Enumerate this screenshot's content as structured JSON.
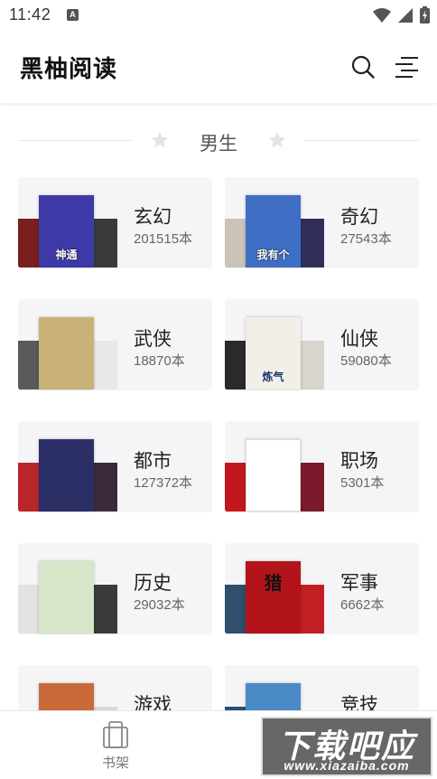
{
  "status_bar": {
    "time": "11:42",
    "notification_icon": "a-icon",
    "icons": [
      "wifi-icon",
      "cellular-icon",
      "battery-icon"
    ]
  },
  "header": {
    "title": "黑柚阅读",
    "search_icon": "search-icon",
    "menu_icon": "menu-icon"
  },
  "section": {
    "title": "男生"
  },
  "categories": [
    {
      "name": "玄幻",
      "count": "201515本",
      "cover_text": "神通",
      "colors": {
        "front": "#3d3aa8",
        "back_left": "#7a1f1f",
        "back_right": "#3a3a3a"
      }
    },
    {
      "name": "奇幻",
      "count": "27543本",
      "cover_text": "我有个",
      "colors": {
        "front": "#3f6fc4",
        "back_left": "#c9c3b8",
        "back_right": "#2f2f5a"
      }
    },
    {
      "name": "武侠",
      "count": "18870本",
      "cover_text": "",
      "colors": {
        "front": "#c9b27a",
        "back_left": "#5a5a5a",
        "back_right": "#e8e8e8"
      }
    },
    {
      "name": "仙侠",
      "count": "59080本",
      "cover_text": "炼气",
      "colors": {
        "front": "#f2efe8",
        "back_left": "#2a2a2a",
        "back_right": "#d9d4cc"
      }
    },
    {
      "name": "都市",
      "count": "127372本",
      "cover_text": "",
      "colors": {
        "front": "#2b2f66",
        "back_left": "#b8262a",
        "back_right": "#3a2a3a"
      }
    },
    {
      "name": "职场",
      "count": "5301本",
      "cover_text": "",
      "colors": {
        "front": "#ffffff",
        "back_left": "#c2181d",
        "back_right": "#7a1a2a"
      }
    },
    {
      "name": "历史",
      "count": "29032本",
      "cover_text": "",
      "colors": {
        "front": "#d7e6c9",
        "back_left": "#e2e2e2",
        "back_right": "#3a3a3a"
      }
    },
    {
      "name": "军事",
      "count": "6662本",
      "cover_text": "猎",
      "colors": {
        "front": "#b3141b",
        "back_left": "#2f4f6a",
        "back_right": "#c21f24"
      }
    },
    {
      "name": "游戏",
      "count": "",
      "cover_text": "",
      "colors": {
        "front": "#c96a3a",
        "back_left": "#f5f5f7",
        "back_right": "#d9d9d9"
      }
    },
    {
      "name": "竞技",
      "count": "",
      "cover_text": "",
      "colors": {
        "front": "#4a8ac7",
        "back_left": "#2a4a7a",
        "back_right": "#f5f5f7"
      }
    }
  ],
  "tab_bar": {
    "bookshelf_label": "书架",
    "bookshelf_icon": "bookshelf-icon"
  },
  "watermark": {
    "main": "下载吧应用",
    "sub": "www.xiazaiba.com"
  }
}
